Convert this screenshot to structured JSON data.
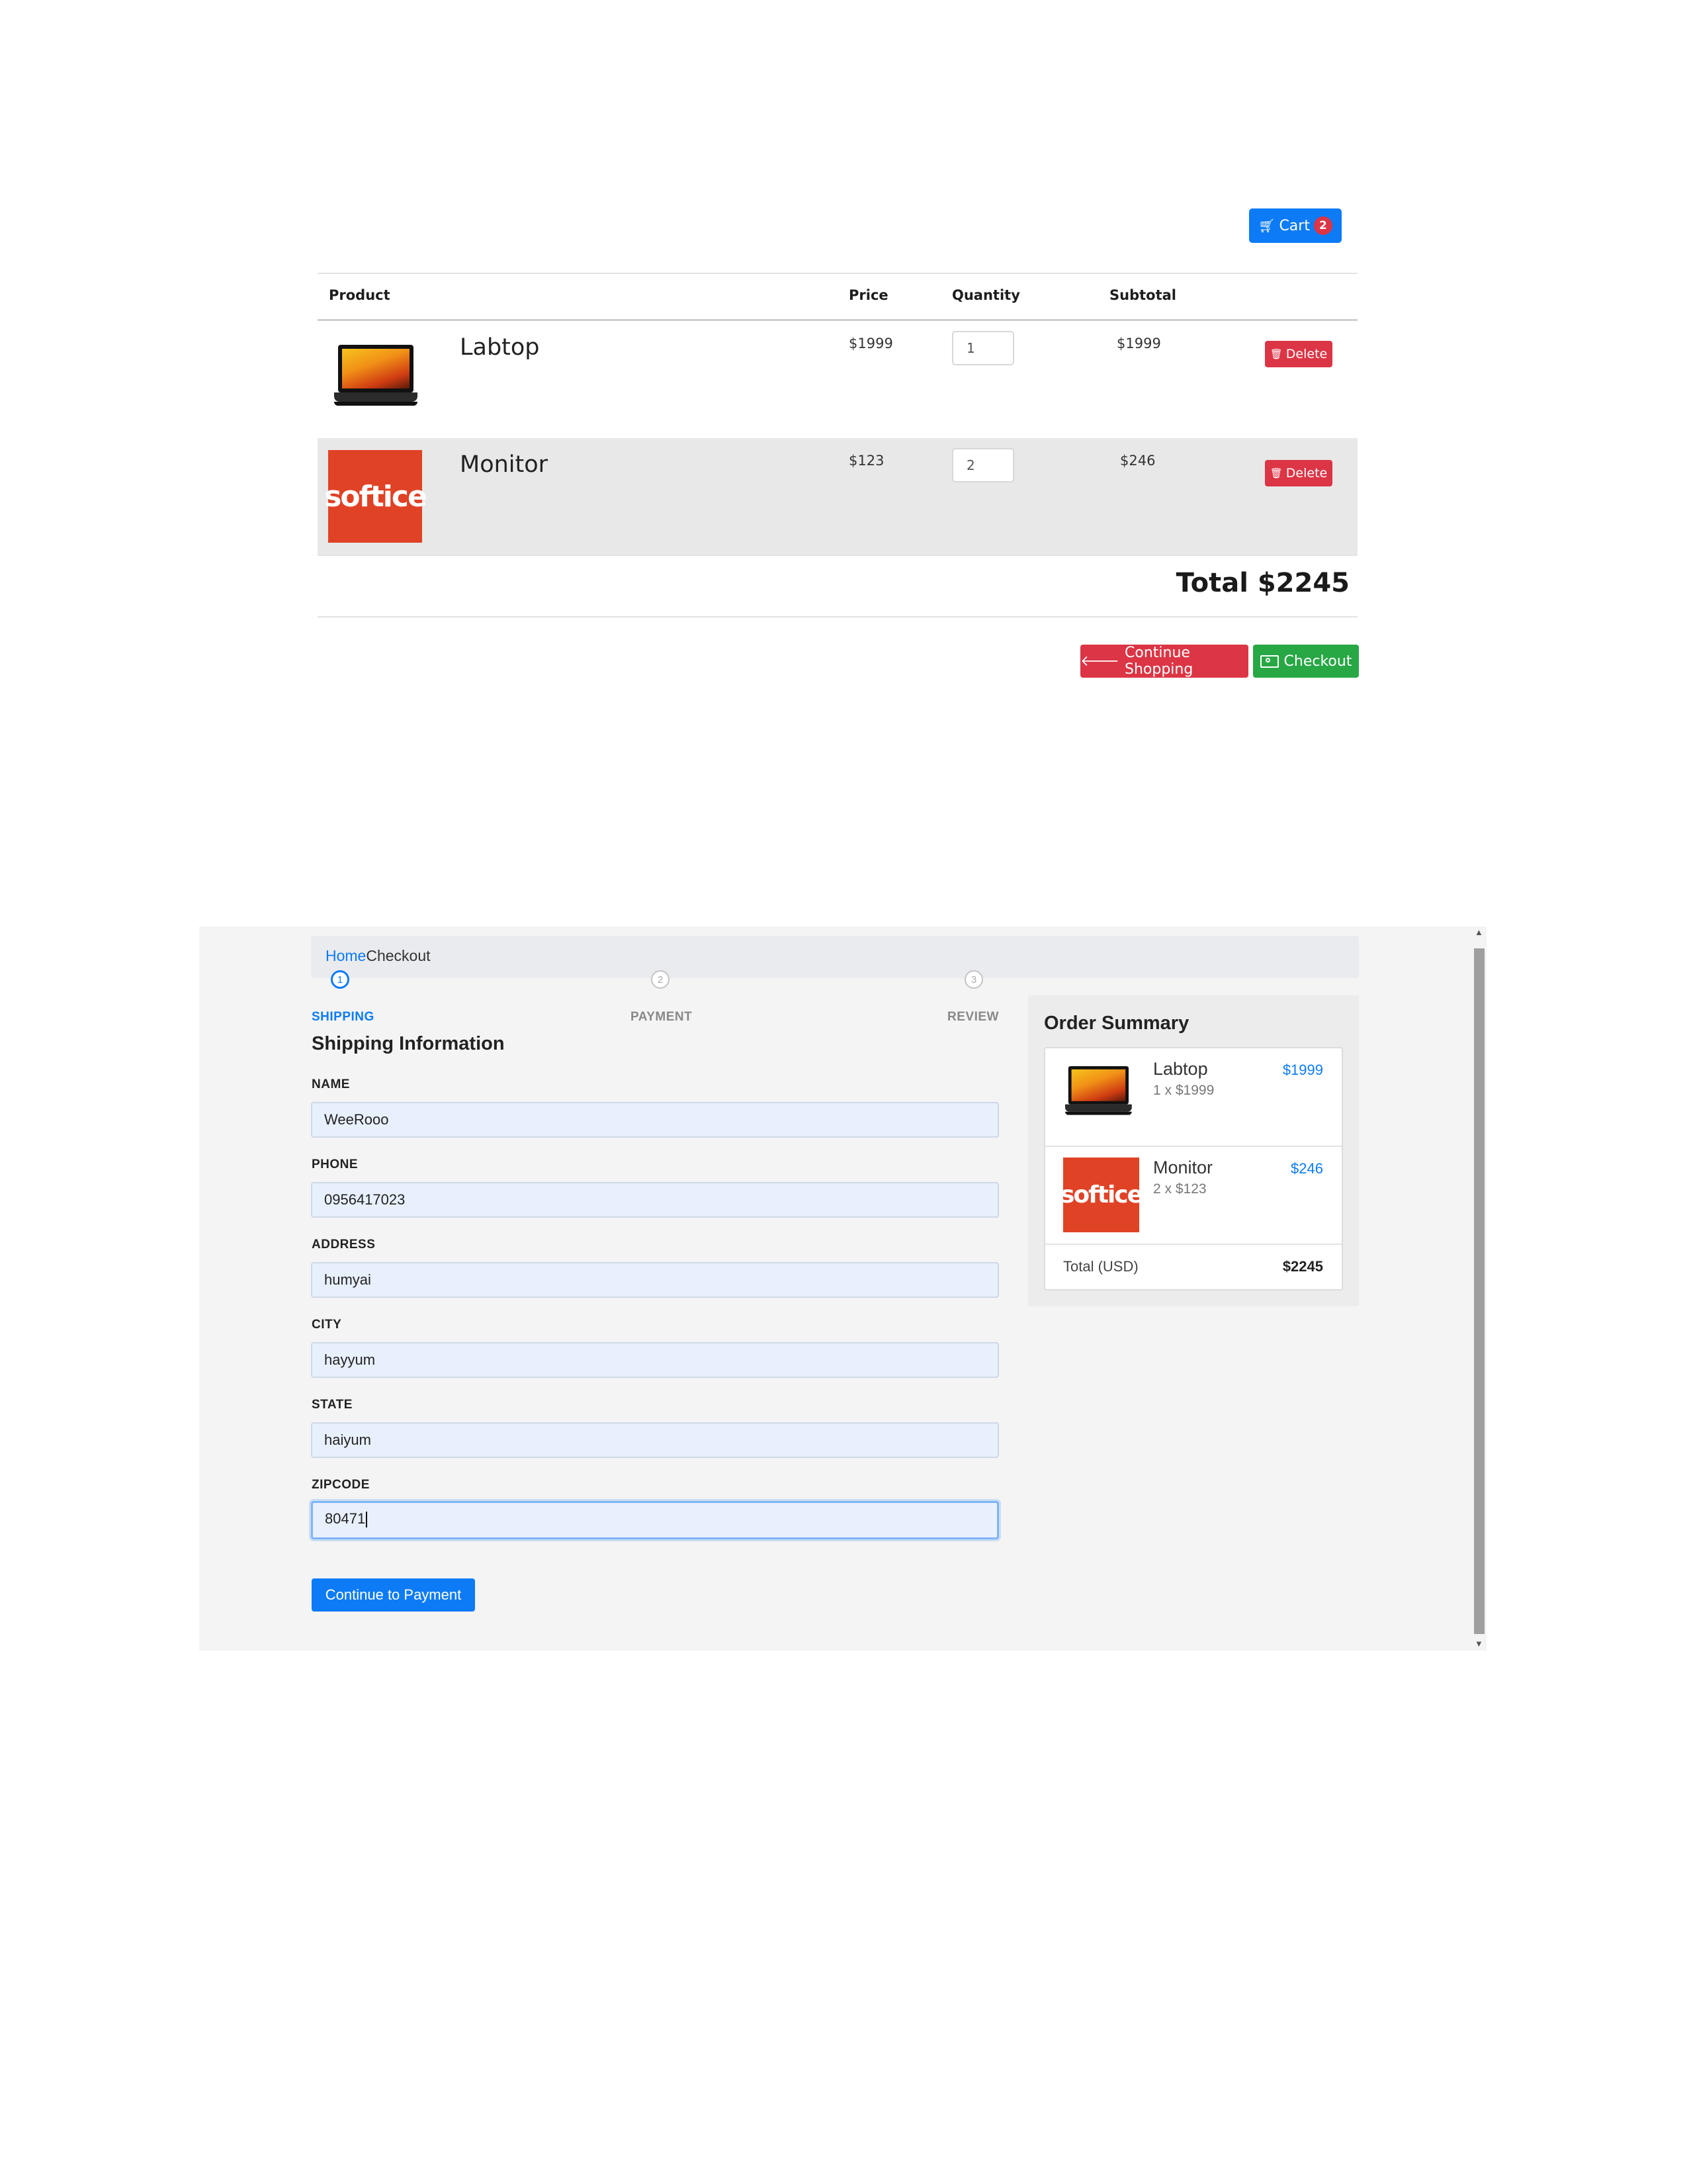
{
  "cart_page": {
    "cart_button": {
      "label": "Cart",
      "count": "2",
      "icon": "shopping-cart-icon"
    },
    "table": {
      "headers": {
        "product": "Product",
        "price": "Price",
        "quantity": "Quantity",
        "subtotal": "Subtotal"
      },
      "rows": [
        {
          "name": "Labtop",
          "price": "$1999",
          "quantity": "1",
          "subtotal": "$1999",
          "delete_label": "Delete",
          "image": "laptop-image"
        },
        {
          "name": "Monitor",
          "price": "$123",
          "quantity": "2",
          "subtotal": "$246",
          "delete_label": "Delete",
          "image": "softice-logo"
        }
      ]
    },
    "total": "Total $2245",
    "continue_shopping": {
      "label": "Continue Shopping",
      "icon": "arrow-left-icon"
    },
    "checkout": {
      "label": "Checkout",
      "icon": "money-icon"
    },
    "colors": {
      "primary": "#0d7bf6",
      "danger": "#dc3545",
      "success": "#28a745"
    }
  },
  "checkout_page": {
    "breadcrumb": {
      "home": "Home",
      "current": "Checkout"
    },
    "steps": [
      {
        "number": "1",
        "label": "SHIPPING",
        "active": true
      },
      {
        "number": "2",
        "label": "PAYMENT",
        "active": false
      },
      {
        "number": "3",
        "label": "REVIEW",
        "active": false
      }
    ],
    "form": {
      "title": "Shipping Information",
      "fields": [
        {
          "label": "NAME",
          "value": "WeeRooo"
        },
        {
          "label": "PHONE",
          "value": "0956417023"
        },
        {
          "label": "ADDRESS",
          "value": "humyai"
        },
        {
          "label": "CITY",
          "value": "hayyum"
        },
        {
          "label": "STATE",
          "value": "haiyum"
        },
        {
          "label": "ZIPCODE",
          "value": "80471"
        }
      ],
      "submit_label": "Continue to Payment"
    },
    "summary": {
      "title": "Order Summary",
      "items": [
        {
          "name": "Labtop",
          "detail": "1 x $1999",
          "price": "$1999"
        },
        {
          "name": "Monitor",
          "detail": "2 x $123",
          "price": "$246"
        }
      ],
      "total_label": "Total (USD)",
      "total_value": "$2245"
    },
    "logo_text": "softice"
  }
}
